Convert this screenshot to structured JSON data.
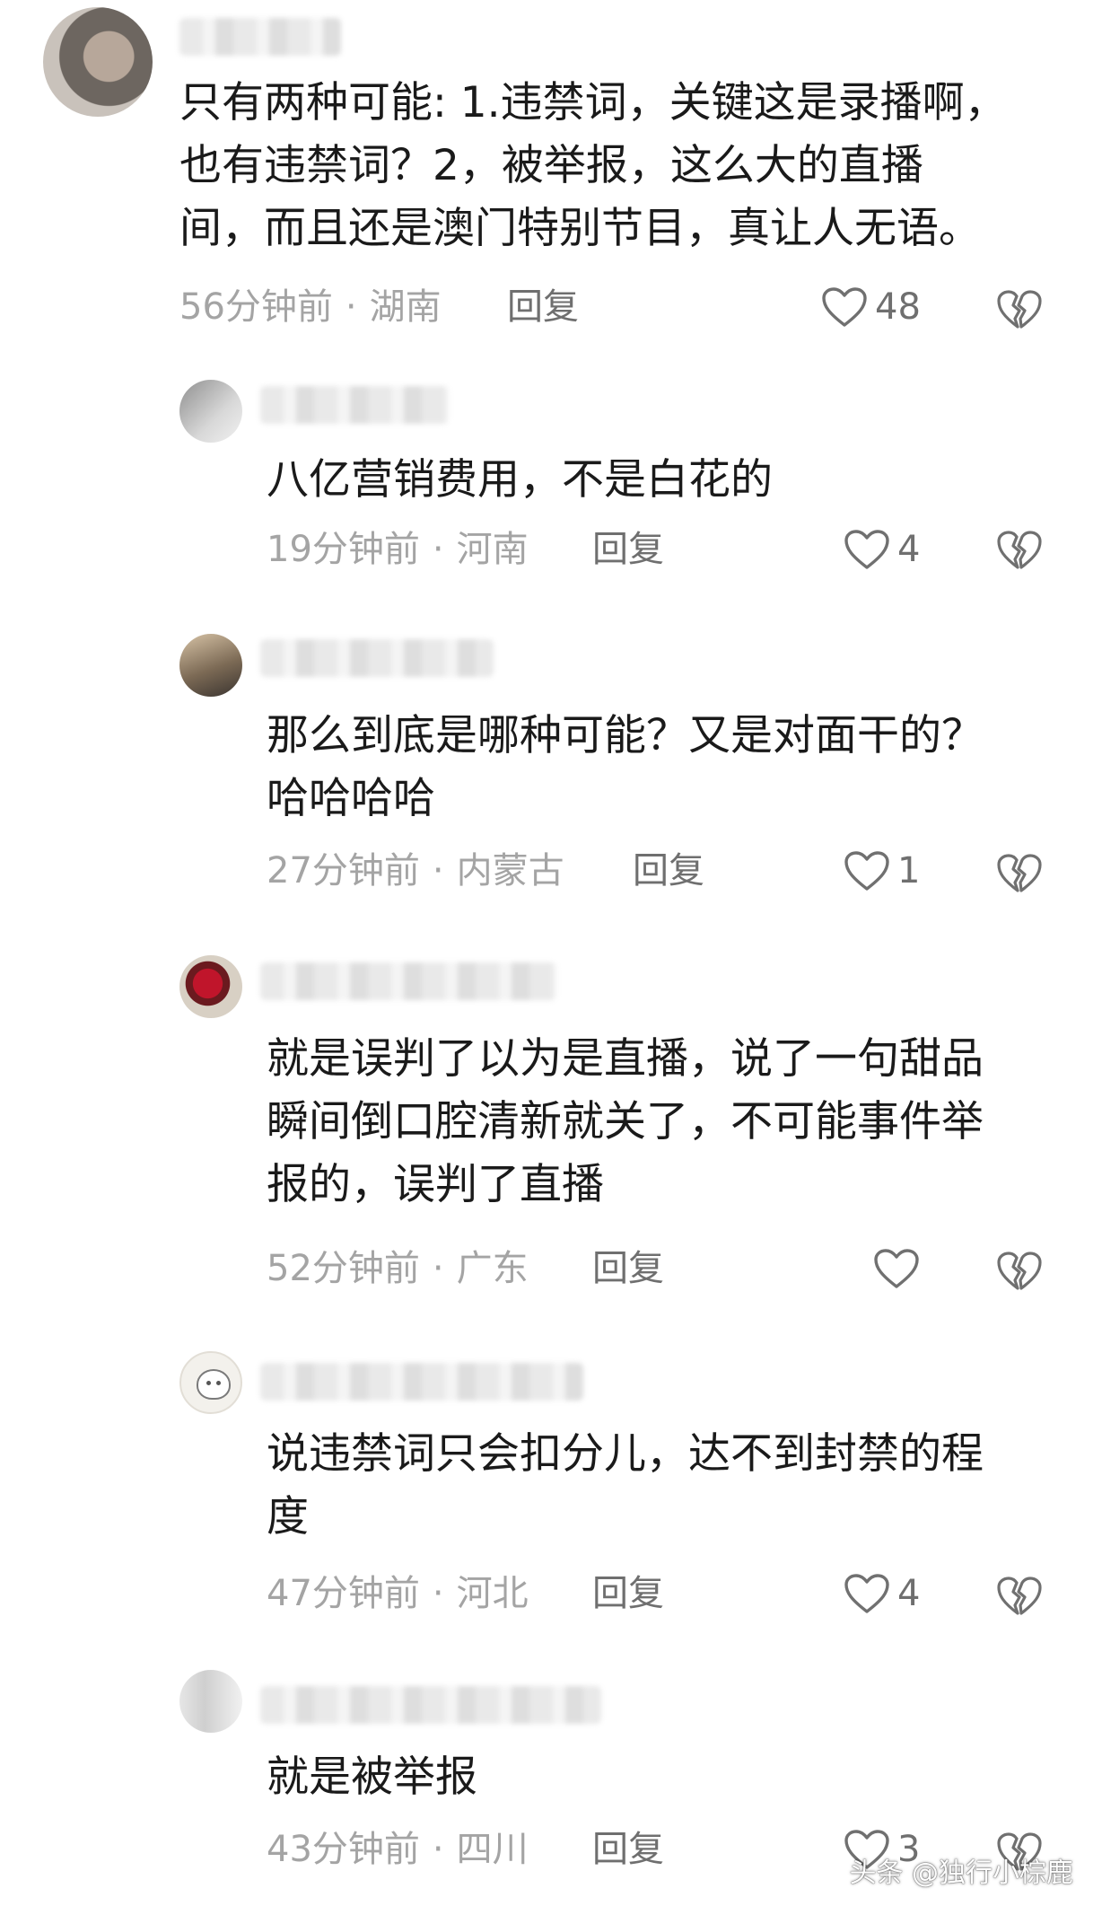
{
  "main_comment": {
    "text": "只有两种可能: 1.违禁词，关键这是录播啊，\n也有违禁词？2，被举报，这么大的直播\n间，而且还是澳门特别节目，真让人无语。",
    "time": "56分钟前",
    "location": "湖南",
    "reply_label": "回复",
    "likes": "48"
  },
  "replies": [
    {
      "text": "八亿营销费用，不是白花的",
      "time": "19分钟前",
      "location": "河南",
      "reply_label": "回复",
      "likes": "4"
    },
    {
      "text": "那么到底是哪种可能？又是对面干的？\n哈哈哈哈",
      "time": "27分钟前",
      "location": "内蒙古",
      "reply_label": "回复",
      "likes": "1"
    },
    {
      "text": "就是误判了以为是直播，说了一句甜品\n瞬间倒口腔清新就关了，不可能事件举\n报的，误判了直播",
      "time": "52分钟前",
      "location": "广东",
      "reply_label": "回复",
      "likes": ""
    },
    {
      "text": "说违禁词只会扣分儿，达不到封禁的程\n度",
      "time": "47分钟前",
      "location": "河北",
      "reply_label": "回复",
      "likes": "4"
    },
    {
      "text": "就是被举报",
      "time": "43分钟前",
      "location": "四川",
      "reply_label": "回复",
      "likes": "3"
    }
  ],
  "separator": "·",
  "watermark": "头条 @独行小棕鹿",
  "icons": {
    "like": "heart-outline-icon",
    "dislike": "broken-heart-icon"
  },
  "colors": {
    "text": "#1a1a1a",
    "meta": "#a4a4a4",
    "action": "#6f6f6f",
    "icon": "#707070"
  }
}
